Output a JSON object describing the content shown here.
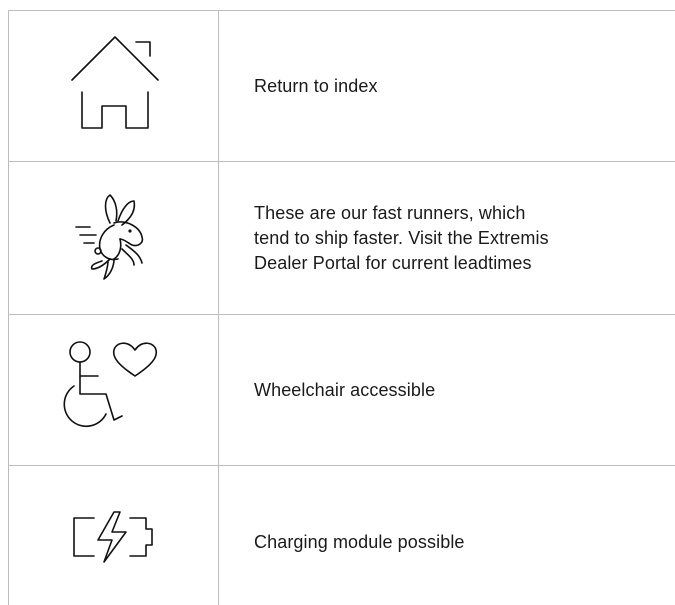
{
  "legend": {
    "rows": [
      {
        "icon": "house-icon",
        "text": "Return to index"
      },
      {
        "icon": "running-rabbit-icon",
        "lines": [
          "These are our fast runners, which",
          "tend to ship faster. Visit the Extremis",
          "Dealer Portal for current leadtimes"
        ]
      },
      {
        "icon": "wheelchair-heart-icon",
        "text": "Wheelchair accessible"
      },
      {
        "icon": "battery-charging-icon",
        "text": "Charging module possible"
      }
    ]
  },
  "colors": {
    "line": "#bdbdbd",
    "text": "#1a1a1a",
    "icon": "#111111"
  }
}
